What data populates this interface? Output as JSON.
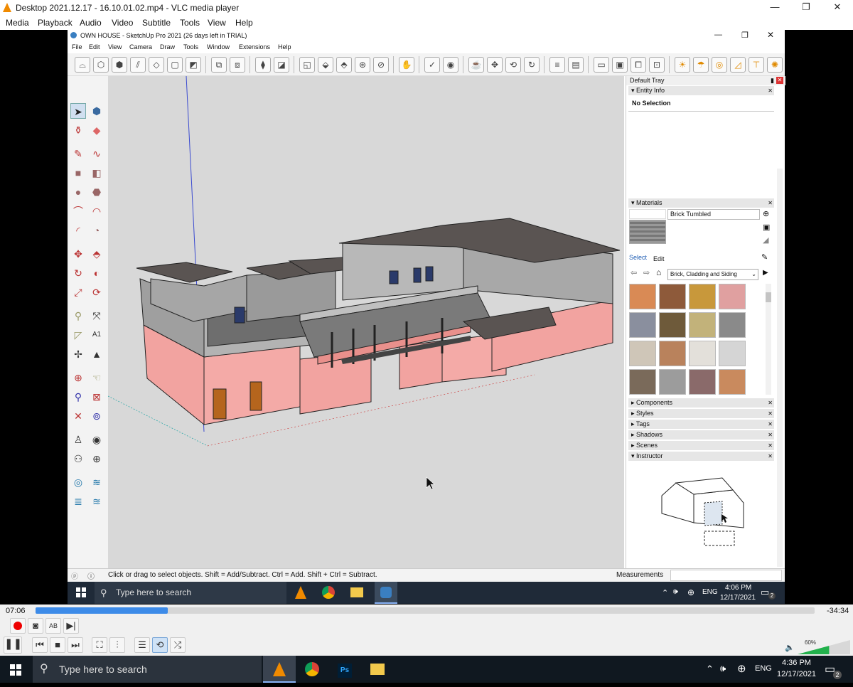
{
  "vlc": {
    "title": "Desktop 2021.12.17 - 16.10.01.02.mp4 - VLC media player",
    "menu": [
      "Media",
      "Playback",
      "Audio",
      "Video",
      "Subtitle",
      "Tools",
      "View",
      "Help"
    ],
    "time_elapsed": "07:06",
    "time_remaining": "-34:34",
    "progress": 0.17,
    "volume_label": "60%",
    "volume": 0.6
  },
  "sketchup": {
    "title": "OWN HOUSE - SketchUp Pro 2021 (26 days left in TRIAL)",
    "menu": [
      "File",
      "Edit",
      "View",
      "Camera",
      "Draw",
      "Tools",
      "Window",
      "Extensions",
      "Help"
    ],
    "status_text": "Click or drag to select objects. Shift = Add/Subtract. Ctrl = Add. Shift + Ctrl = Subtract.",
    "measurements_label": "Measurements",
    "tray": {
      "title": "Default Tray",
      "entity_info": "Entity Info",
      "no_selection": "No Selection",
      "materials": "Materials",
      "material_name": "Brick Tumbled",
      "tab_select": "Select",
      "tab_edit": "Edit",
      "category": "Brick, Cladding and Siding",
      "swatches": [
        "#d98a55",
        "#8e5a3a",
        "#c8983b",
        "#e0a0a0",
        "#8a8f9e",
        "#6e5a3a",
        "#c2b27a",
        "#8a8a8a",
        "#cfc6b8",
        "#b9825c",
        "#e3e0da",
        "#d5d5d5",
        "#7a6a5a",
        "#9c9c9c",
        "#8a6a6a",
        "#c98a5e"
      ],
      "collapsed": [
        "Components",
        "Styles",
        "Tags",
        "Shadows",
        "Scenes"
      ],
      "instructor": "Instructor"
    },
    "colors": {
      "wall_pink": "#f2a3a0",
      "roof": "#5a5452",
      "upper_wall": "#a9a9a9",
      "viewport": "#d8d8d8"
    }
  },
  "inner_taskbar": {
    "search": "Type here to search",
    "lang": "ENG",
    "time": "4:06 PM",
    "date": "12/17/2021",
    "notif": "2"
  },
  "win_taskbar": {
    "search": "Type here to search",
    "lang": "ENG",
    "time": "4:36 PM",
    "date": "12/17/2021",
    "notif": "2",
    "ps_label": "Ps"
  }
}
